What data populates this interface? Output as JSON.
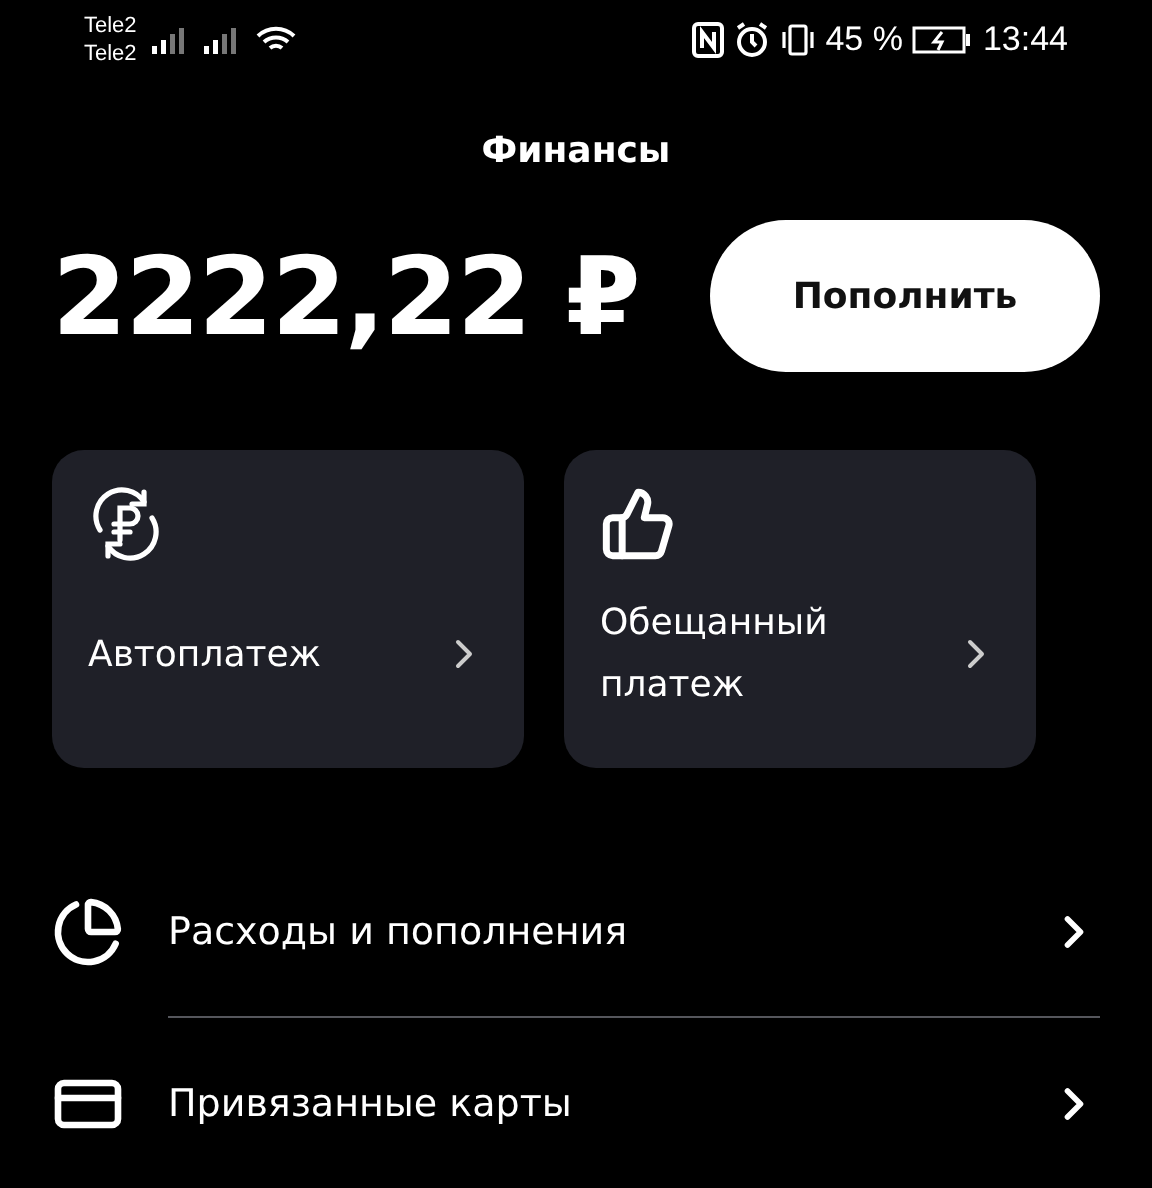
{
  "status_bar": {
    "carriers": [
      "Tele2",
      "Tele2"
    ],
    "battery": "45 %",
    "time": "13:44"
  },
  "title": "Финансы",
  "balance": "2222,22 ₽",
  "top_up_button": "Пополнить",
  "cards": [
    {
      "kind": "autopay",
      "label": "Автоплатеж"
    },
    {
      "kind": "promised",
      "label": "Обещанный платеж"
    }
  ],
  "menu": [
    {
      "kind": "expenses",
      "label": "Расходы и пополнения"
    },
    {
      "kind": "cards",
      "label": "Привязанные карты"
    }
  ]
}
